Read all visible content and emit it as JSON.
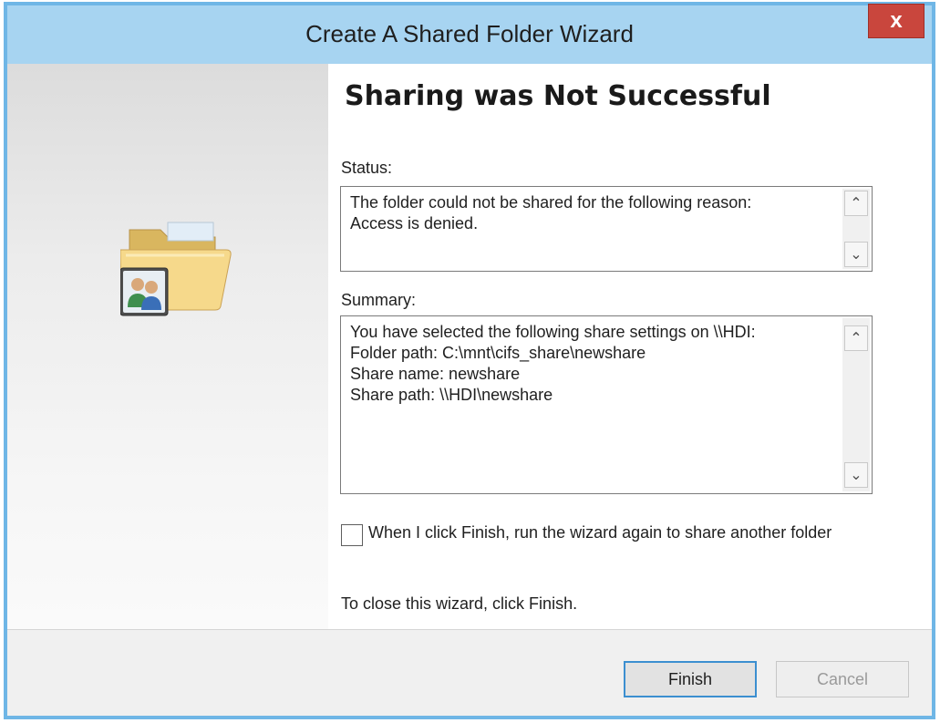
{
  "window": {
    "title": "Create A Shared Folder Wizard",
    "close_label": "x"
  },
  "page": {
    "heading": "Sharing was Not Successful"
  },
  "status": {
    "label": "Status:",
    "text": "The folder could not be shared for the following reason:\nAccess is denied."
  },
  "summary": {
    "label": "Summary:",
    "text": "You have selected the following share settings on \\\\HDI:\nFolder path: C:\\mnt\\cifs_share\\newshare\nShare name: newshare\nShare path: \\\\HDI\\newshare"
  },
  "options": {
    "run_again_label": "When I click Finish, run the wizard again to share another folder",
    "run_again_checked": false
  },
  "footer": {
    "instruction": "To close this wizard, click Finish."
  },
  "buttons": {
    "finish": "Finish",
    "cancel": "Cancel"
  },
  "icons": {
    "wizard_image": "shared-folder-icon",
    "scroll_up": "chevron-up-icon",
    "scroll_down": "chevron-down-icon"
  },
  "colors": {
    "titlebar": "#a7d4f1",
    "window_border": "#6fb6e6",
    "close_button": "#c9463d",
    "default_button_border": "#3c8fd0"
  }
}
